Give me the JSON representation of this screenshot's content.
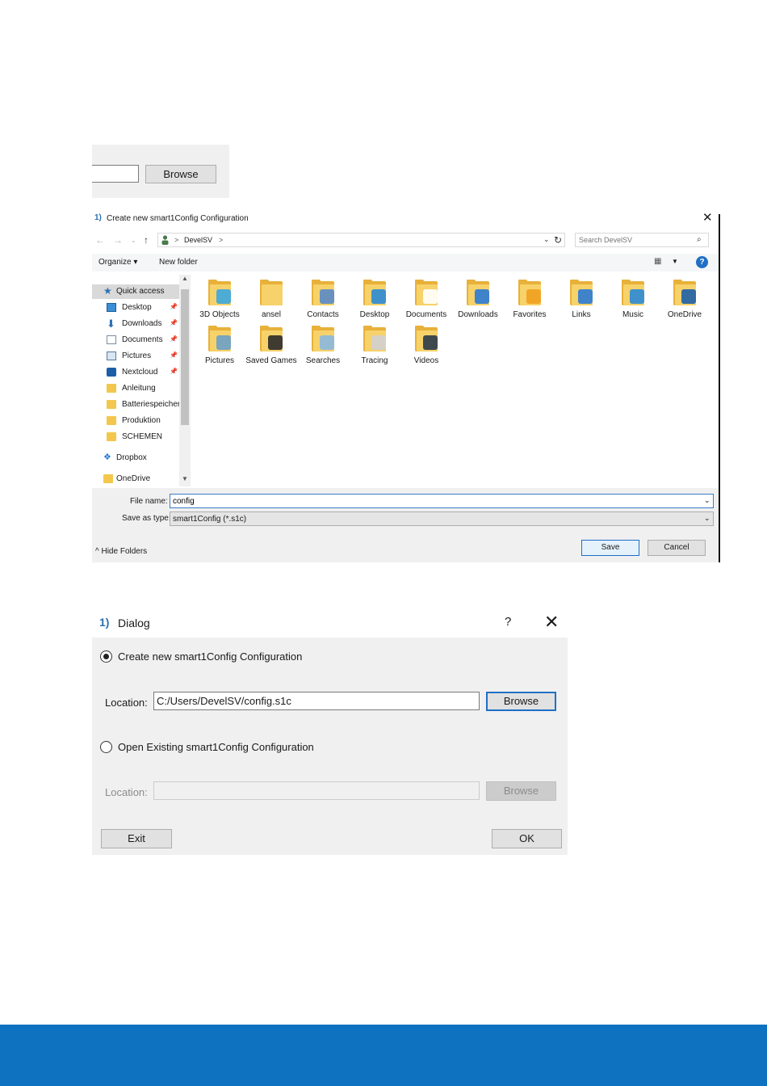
{
  "crop_top": {
    "browse_label": "Browse"
  },
  "save_dialog": {
    "title": "Create new smart1Config Configuration",
    "app_icon": "1)",
    "breadcrumb": {
      "separator": ">",
      "folder": "DevelSV",
      "trailing": ">"
    },
    "search": {
      "placeholder": "Search DevelSV"
    },
    "toolbar": {
      "organize": "Organize ▾",
      "new_folder": "New folder",
      "help": "?"
    },
    "nav_items": [
      {
        "label": "Quick access",
        "icon": "star-icon",
        "pinned": false
      },
      {
        "label": "Desktop",
        "icon": "desktop-icon",
        "pinned": true
      },
      {
        "label": "Downloads",
        "icon": "download-icon",
        "pinned": true
      },
      {
        "label": "Documents",
        "icon": "document-icon",
        "pinned": true
      },
      {
        "label": "Pictures",
        "icon": "pictures-icon",
        "pinned": true
      },
      {
        "label": "Nextcloud",
        "icon": "nextcloud-icon",
        "pinned": true
      },
      {
        "label": "Anleitung",
        "icon": "folder-icon",
        "pinned": false
      },
      {
        "label": "Batteriespeicher",
        "icon": "folder-icon",
        "pinned": false
      },
      {
        "label": "Produktion",
        "icon": "folder-icon",
        "pinned": false
      },
      {
        "label": "SCHEMEN",
        "icon": "folder-icon",
        "pinned": false
      },
      {
        "label": "Dropbox",
        "icon": "dropbox-icon",
        "pinned": false
      },
      {
        "label": "OneDrive",
        "icon": "folder-icon",
        "pinned": false
      }
    ],
    "files": [
      {
        "name": "3D Objects",
        "icon": "3d-objects-folder-icon"
      },
      {
        "name": "ansel",
        "icon": "folder-icon"
      },
      {
        "name": "Contacts",
        "icon": "contacts-folder-icon"
      },
      {
        "name": "Desktop",
        "icon": "desktop-folder-icon"
      },
      {
        "name": "Documents",
        "icon": "documents-folder-icon"
      },
      {
        "name": "Downloads",
        "icon": "downloads-folder-icon"
      },
      {
        "name": "Favorites",
        "icon": "favorites-folder-icon"
      },
      {
        "name": "Links",
        "icon": "links-folder-icon"
      },
      {
        "name": "Music",
        "icon": "music-folder-icon"
      },
      {
        "name": "OneDrive",
        "icon": "onedrive-folder-icon"
      },
      {
        "name": "Pictures",
        "icon": "pictures-folder-icon"
      },
      {
        "name": "Saved Games",
        "icon": "saved-games-folder-icon"
      },
      {
        "name": "Searches",
        "icon": "searches-folder-icon"
      },
      {
        "name": "Tracing",
        "icon": "tracing-folder-icon"
      },
      {
        "name": "Videos",
        "icon": "videos-folder-icon"
      }
    ],
    "file_name_label": "File name:",
    "file_name_value": "config",
    "save_type_label": "Save as type:",
    "save_type_value": "smart1Config (*.s1c)",
    "hide_folders": "Hide Folders",
    "save_label": "Save",
    "cancel_label": "Cancel"
  },
  "dialog": {
    "app_icon": "1)",
    "title": "Dialog",
    "help": "?",
    "close": "✕",
    "create_label": "Create new smart1Config Configuration",
    "location_label": "Location:",
    "create_location_value": "C:/Users/DevelSV/config.s1c",
    "browse_label": "Browse",
    "open_label": "Open Existing smart1Config Configuration",
    "open_location_label": "Location:",
    "open_location_value": "",
    "open_browse_label": "Browse",
    "exit_label": "Exit",
    "ok_label": "OK",
    "create_selected": true
  },
  "colors": {
    "accent": "#1f6fc5",
    "footer": "#0f72c0",
    "folder": "#f7d26a"
  }
}
